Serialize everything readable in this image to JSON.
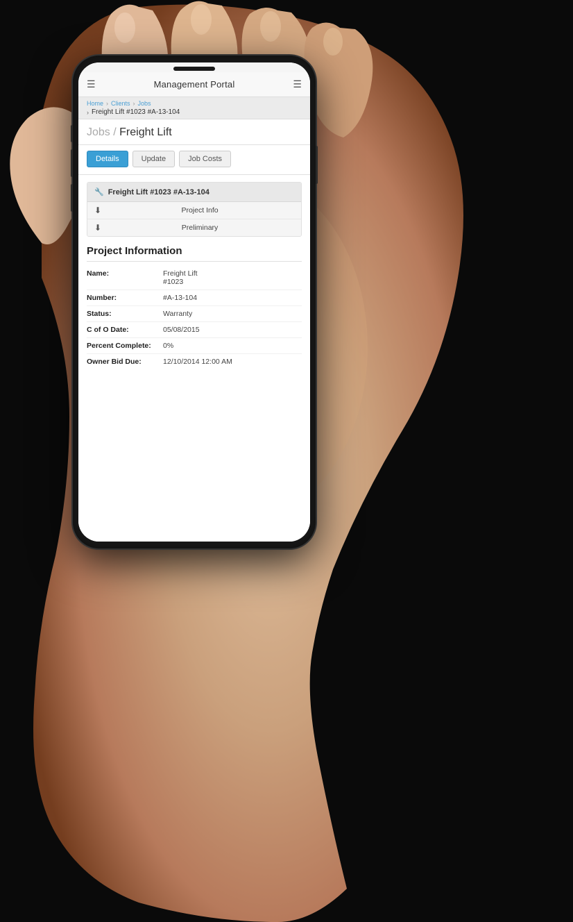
{
  "background": {
    "color": "#c8956a"
  },
  "header": {
    "title": "Management Portal",
    "menu_icon": "☰",
    "right_icon": "☰"
  },
  "breadcrumb": {
    "items": [
      "Home",
      "Clients",
      "Jobs"
    ],
    "current": "Freight Lift #1023 #A-13-104",
    "arrow": "›"
  },
  "page_title": {
    "prefix": "Jobs /",
    "title": "Freight Lift"
  },
  "tabs": [
    {
      "label": "Details",
      "active": true
    },
    {
      "label": "Update",
      "active": false
    },
    {
      "label": "Job Costs",
      "active": false
    }
  ],
  "project_card": {
    "title": "Freight Lift #1023 #A-13-104",
    "rows": [
      {
        "label": "Project Info"
      },
      {
        "label": "Preliminary"
      }
    ]
  },
  "project_info": {
    "section_title": "Project Information",
    "fields": [
      {
        "label": "Name:",
        "value": "Freight Lift\n#1023"
      },
      {
        "label": "Number:",
        "value": "#A-13-104"
      },
      {
        "label": "Status:",
        "value": "Warranty"
      },
      {
        "label": "C of O Date:",
        "value": "05/08/2015"
      },
      {
        "label": "Percent Complete:",
        "value": "0%"
      },
      {
        "label": "Owner Bid Due:",
        "value": "12/10/2014 12:00 AM"
      }
    ]
  }
}
